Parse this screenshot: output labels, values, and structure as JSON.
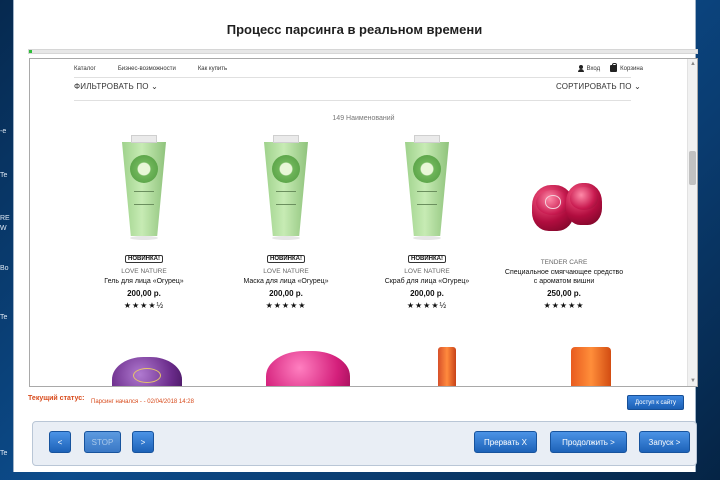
{
  "window": {
    "title": "Процесс парсинга в реальном времени",
    "progress_fraction": 0.004
  },
  "desktop": {
    "labels": [
      "-e",
      "Te",
      "RE",
      "W",
      "Bo",
      "Te",
      "Te"
    ]
  },
  "site": {
    "nav": [
      "Каталог",
      "Бизнес-возможности",
      "Как купить"
    ],
    "login": "Вход",
    "cart": "Корзина",
    "filter": "ФИЛЬТРОВАТЬ ПО ⌄",
    "sort": "СОРТИРОВАТЬ ПО ⌄",
    "count": "149 Наименований",
    "products": [
      {
        "badge": "НОВИНКА!",
        "brand": "LOVE NATURE",
        "name": "Гель для лица «Огурец»",
        "price": "200,00 р.",
        "stars": "★★★★½"
      },
      {
        "badge": "НОВИНКА!",
        "brand": "LOVE NATURE",
        "name": "Маска для лица «Огурец»",
        "price": "200,00 р.",
        "stars": "★★★★★"
      },
      {
        "badge": "НОВИНКА!",
        "brand": "LOVE NATURE",
        "name": "Скраб для лица «Огурец»",
        "price": "200,00 р.",
        "stars": "★★★★½"
      },
      {
        "badge": "",
        "brand": "TENDER CARE",
        "name": "Специальное смягчающее средство",
        "name2": "с ароматом вишни",
        "price": "250,00 р.",
        "stars": "★★★★★"
      }
    ]
  },
  "status": {
    "label": "Текущий статус:",
    "text": "Парсинг начался - - 02/04/2018 14:28",
    "site_button": "Доступ к сайту"
  },
  "controls": {
    "prev": "<",
    "stop": "STOP",
    "next": ">",
    "interrupt": "Прервать X",
    "continue": "Продолжить >",
    "start": "Запуск >"
  },
  "colors": {
    "accent": "#1d62b8",
    "status": "#d84a1b",
    "progress": "#2fbf3a"
  }
}
